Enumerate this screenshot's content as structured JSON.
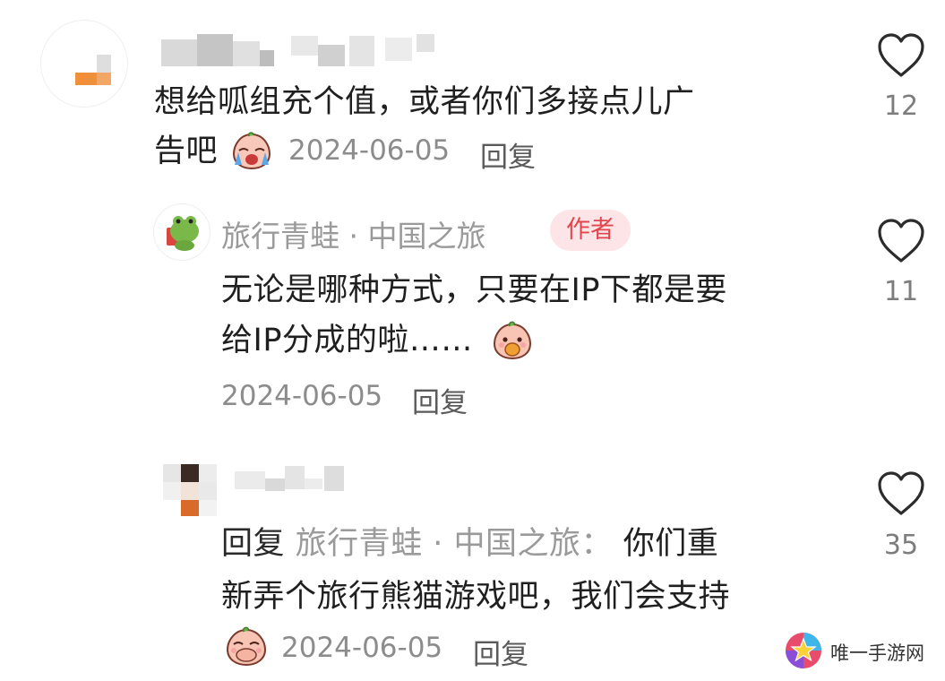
{
  "comments": [
    {
      "text_line1": "想给呱组充个值，或者你们多接点儿广",
      "text_line2": "告吧",
      "date": "2024-06-05",
      "reply_label": "回复",
      "like_count": "12"
    },
    {
      "author": "旅行青蛙 · 中国之旅",
      "badge": "作者",
      "text_line1": "无论是哪种方式，只要在IP下都是要",
      "text_line2": "给IP分成的啦……",
      "date": "2024-06-05",
      "reply_label": "回复",
      "like_count": "11"
    },
    {
      "reply_prefix": "回复",
      "reply_target": "旅行青蛙 · 中国之旅：",
      "text_line1_rest": "你们重",
      "text_line2": "新弄个旅行熊猫游戏吧，我们会支持",
      "date": "2024-06-05",
      "reply_label": "回复",
      "like_count": "35"
    }
  ],
  "watermark": {
    "text": "唯一手游网"
  },
  "colors": {
    "badge_bg": "#fde4e6",
    "badge_text": "#e1464f",
    "meta_gray": "#8c8c8c"
  },
  "icons": [
    "heart-outline-icon",
    "crying-emoji-icon",
    "peach-eating-emoji-icon",
    "peach-covering-mouth-emoji-icon",
    "frog-avatar-icon",
    "star-logo-icon"
  ]
}
